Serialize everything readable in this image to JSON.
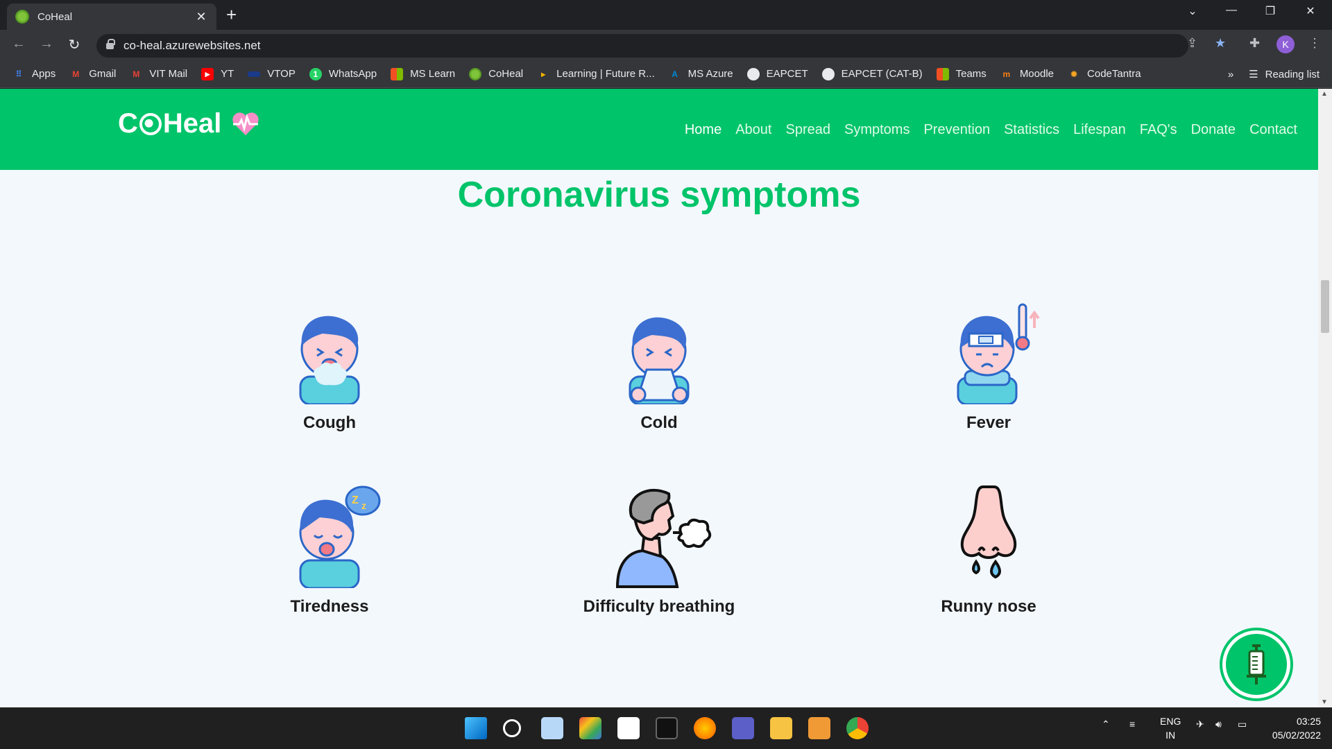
{
  "browser": {
    "tab_title": "CoHeal",
    "tab_close": "✕",
    "new_tab": "+",
    "url": "co-heal.azurewebsites.net",
    "bookmarks": [
      {
        "label": "Apps",
        "icon": "apps-grid-icon",
        "color": "#4285f4"
      },
      {
        "label": "Gmail",
        "icon": "gmail-icon",
        "color": "#ea4335"
      },
      {
        "label": "VIT Mail",
        "icon": "gmail-icon",
        "color": "#ea4335"
      },
      {
        "label": "YT",
        "icon": "youtube-icon",
        "color": "#ff0000"
      },
      {
        "label": "VTOP",
        "icon": "vtop-icon",
        "color": "#1a3a8a"
      },
      {
        "label": "WhatsApp",
        "icon": "whatsapp-icon",
        "color": "#25d366"
      },
      {
        "label": "MS Learn",
        "icon": "microsoft-icon",
        "color": "#f25022"
      },
      {
        "label": "CoHeal",
        "icon": "virus-icon",
        "color": "#5aa82a"
      },
      {
        "label": "Learning | Future R...",
        "icon": "learning-icon",
        "color": "#f4b400"
      },
      {
        "label": "MS Azure",
        "icon": "azure-icon",
        "color": "#0089d6"
      },
      {
        "label": "EAPCET",
        "icon": "globe-icon",
        "color": "#e8eaed"
      },
      {
        "label": "EAPCET (CAT-B)",
        "icon": "globe-icon",
        "color": "#e8eaed"
      },
      {
        "label": "Teams",
        "icon": "microsoft-icon",
        "color": "#f25022"
      },
      {
        "label": "Moodle",
        "icon": "moodle-icon",
        "color": "#f98012"
      },
      {
        "label": "CodeTantra",
        "icon": "codetantra-icon",
        "color": "#f5a623"
      }
    ],
    "more": "»",
    "reading_list": "Reading list",
    "profile_initial": "K"
  },
  "site": {
    "brand": {
      "left": "C",
      "right": "Heal"
    },
    "nav": [
      "Home",
      "About",
      "Spread",
      "Symptoms",
      "Prevention",
      "Statistics",
      "Lifespan",
      "FAQ's",
      "Donate",
      "Contact"
    ],
    "active_nav": "Home",
    "section_title": "Coronavirus symptoms",
    "symptoms": [
      {
        "label": "Cough",
        "icon": "cough-icon"
      },
      {
        "label": "Cold",
        "icon": "cold-icon"
      },
      {
        "label": "Fever",
        "icon": "fever-icon"
      },
      {
        "label": "Tiredness",
        "icon": "tiredness-icon"
      },
      {
        "label": "Difficulty breathing",
        "icon": "difficulty-breathing-icon"
      },
      {
        "label": "Runny nose",
        "icon": "runny-nose-icon"
      }
    ],
    "colors": {
      "brand_green": "#00c46a",
      "page_bg": "#f3f8fd"
    }
  },
  "taskbar": {
    "lang_top": "ENG",
    "lang_bottom": "IN",
    "time": "03:25",
    "date": "05/02/2022"
  }
}
